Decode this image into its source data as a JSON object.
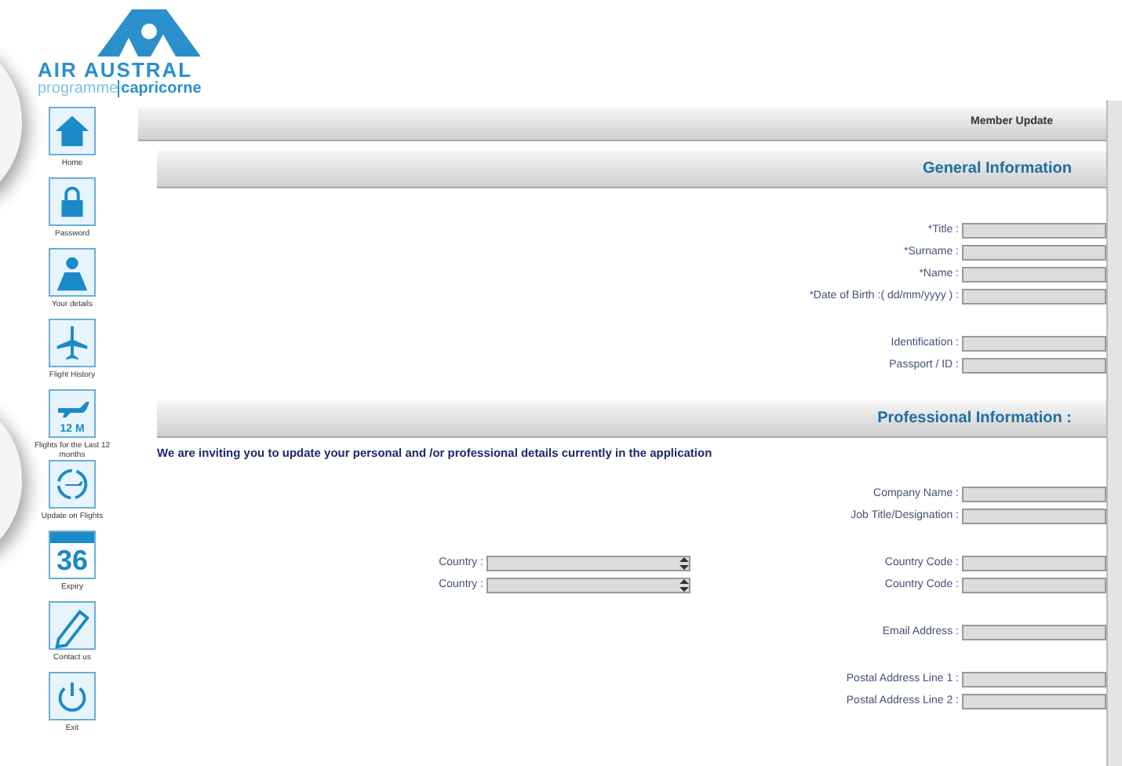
{
  "logo": {
    "brand": "AIR AUSTRAL",
    "program": "programme",
    "program_name": "capricorne"
  },
  "sidebar": {
    "items": [
      {
        "kind": "home",
        "label": "Home"
      },
      {
        "kind": "lock",
        "label": "Password"
      },
      {
        "kind": "person",
        "label": "Your details"
      },
      {
        "kind": "plane",
        "label": "Flight History"
      },
      {
        "kind": "plane-text",
        "icon_text": "12 M",
        "label": "Flights for the Last 12 months"
      },
      {
        "kind": "plane-circle",
        "label": "Update on Flights"
      },
      {
        "kind": "calendar",
        "icon_text": "36",
        "label": "Expiry"
      },
      {
        "kind": "pencil",
        "label": "Contact us"
      },
      {
        "kind": "power",
        "label": "Exit"
      }
    ]
  },
  "page_title": "Member Update",
  "sections": [
    {
      "heading": "General Information",
      "groups": [
        [
          {
            "right": {
              "label": "*Title :",
              "kind": "text"
            }
          },
          {
            "right": {
              "label": "*Surname :",
              "kind": "text"
            }
          },
          {
            "right": {
              "label": "*Name :",
              "kind": "text"
            }
          },
          {
            "right": {
              "label": "*Date of Birth :( dd/mm/yyyy ) :",
              "kind": "text"
            }
          }
        ],
        [
          {
            "right": {
              "label": "Identification :",
              "kind": "text"
            }
          },
          {
            "right": {
              "label": "Passport / ID :",
              "kind": "text"
            }
          }
        ]
      ]
    },
    {
      "heading": "Professional Information :",
      "message": "We are inviting you to update your personal and /or professional details currently in the application",
      "groups": [
        [
          {
            "right": {
              "label": "Company Name :",
              "kind": "text"
            }
          },
          {
            "right": {
              "label": "Job Title/Designation :",
              "kind": "text"
            }
          }
        ],
        [
          {
            "left": {
              "label": "Country :",
              "kind": "select"
            },
            "right": {
              "label": "Country Code :",
              "kind": "text"
            }
          },
          {
            "left": {
              "label": "Country :",
              "kind": "select"
            },
            "right": {
              "label": "Country Code :",
              "kind": "text"
            }
          }
        ],
        [
          {
            "right": {
              "label": "Email Address :",
              "kind": "text"
            }
          }
        ],
        [
          {
            "right": {
              "label": "Postal Address Line 1 :",
              "kind": "text"
            }
          },
          {
            "right": {
              "label": "Postal Address Line 2 :",
              "kind": "text"
            }
          }
        ]
      ]
    }
  ]
}
